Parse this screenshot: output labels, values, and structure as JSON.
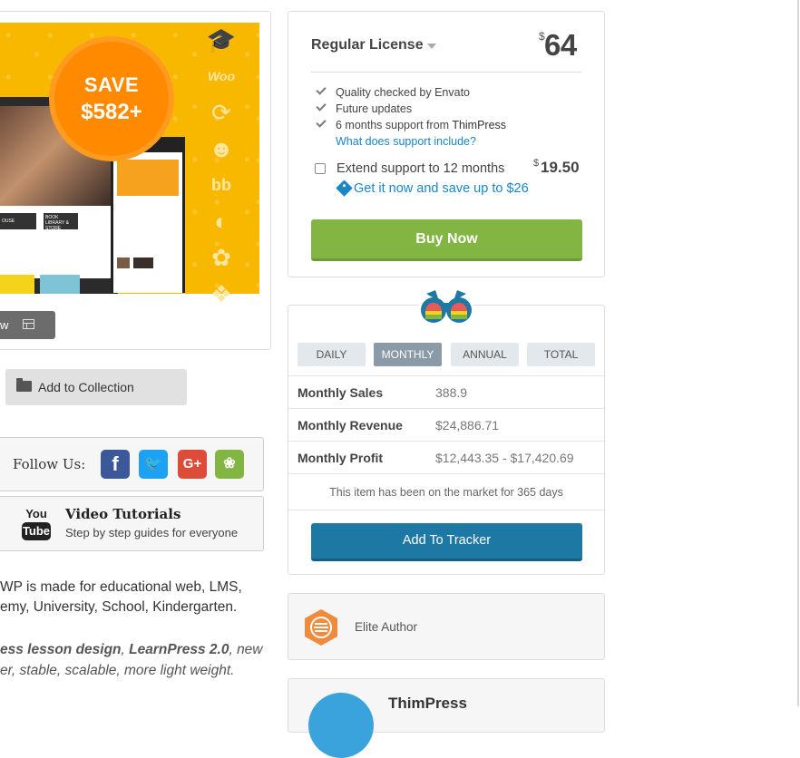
{
  "preview": {
    "save_line1": "SAVE",
    "save_line2": "$582+",
    "side_icons": [
      "graduation-cap-icon",
      "woo-icon",
      "refresh-icon",
      "user-circle-icon",
      "bbpress-icon",
      "buddy-icon",
      "certificate-icon",
      "puzzle-icon"
    ],
    "woo_text": "Woo",
    "preview_button_label": "w",
    "laptop_bar1": "OUSE",
    "laptop_bar2": "BOOK LIBRARY & STORE"
  },
  "collection": {
    "label": "Add to Collection"
  },
  "follow": {
    "label": "Follow Us:",
    "networks": [
      {
        "name": "facebook",
        "glyph": "f"
      },
      {
        "name": "twitter",
        "glyph": "t"
      },
      {
        "name": "google-plus",
        "glyph": "G+"
      },
      {
        "name": "envato",
        "glyph": "e"
      }
    ]
  },
  "video": {
    "logo_top": "You",
    "logo_bottom": "Tube",
    "title": "Video Tutorials",
    "subtitle": "Step by step guides for everyone"
  },
  "description": {
    "line1": "WP is made for educational web, LMS,",
    "line2": "emy, University, School, Kindergarten.",
    "italic_line1_a": "ess lesson design",
    "italic_line1_sep": ", ",
    "italic_line1_b": "LearnPress 2.0",
    "italic_line1_c": ", new",
    "italic_line2": "er, stable, scalable, more light weight."
  },
  "license": {
    "title": "Regular License",
    "currency": "$",
    "price": "64",
    "features": [
      {
        "text": "Quality checked by Envato"
      },
      {
        "text": "Future updates"
      },
      {
        "text_a": "6 months support from ",
        "text_b": "ThimPress"
      }
    ],
    "support_link": "What does support include?",
    "extend_label": "Extend support to 12 months",
    "extend_currency": "$",
    "extend_price": "19.50",
    "save_link": "Get it now and save up to $26",
    "buy_label": "Buy Now"
  },
  "stats": {
    "tabs": [
      {
        "label": "DAILY",
        "active": false
      },
      {
        "label": "MONTHLY",
        "active": true
      },
      {
        "label": "ANNUAL",
        "active": false
      },
      {
        "label": "TOTAL",
        "active": false
      }
    ],
    "rows": [
      {
        "label": "Monthly Sales",
        "value": "388.9"
      },
      {
        "label": "Monthly Revenue",
        "value": "$24,886.71"
      },
      {
        "label": "Monthly Profit",
        "value": "$12,443.35 - $17,420.69"
      }
    ],
    "market_note": "This item has been on the market for 365 days",
    "tracker_label": "Add To Tracker"
  },
  "author": {
    "badge_label": "Elite Author"
  },
  "profile": {
    "name": "ThimPress"
  },
  "colors": {
    "banner": "#f9b800",
    "save_badge": "#ff8a00",
    "buy_green": "#82b541",
    "tracker_blue": "#1d79a4",
    "link_blue": "#1a86c8",
    "active_tab": "#8a9aa6"
  }
}
